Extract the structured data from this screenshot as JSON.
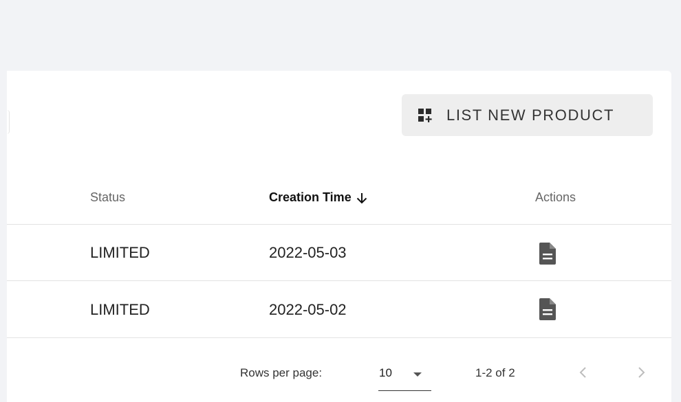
{
  "toolbar": {
    "list_button_label": "LIST NEW PRODUCT",
    "list_button_icon": "add-grid-icon"
  },
  "table": {
    "columns": [
      {
        "key": "status",
        "label": "Status"
      },
      {
        "key": "creation_time",
        "label": "Creation Time",
        "sort": "descending"
      },
      {
        "key": "actions",
        "label": "Actions"
      }
    ],
    "rows": [
      {
        "status": "LIMITED",
        "creation_time": "2022-05-03",
        "action_icon": "document-icon"
      },
      {
        "status": "LIMITED",
        "creation_time": "2022-05-02",
        "action_icon": "document-icon"
      }
    ]
  },
  "pagination": {
    "rows_per_page_label": "Rows per page:",
    "rows_per_page_value": "10",
    "range_text": "1-2 of 2"
  },
  "colors": {
    "page_background": "#f2f3f6",
    "card_background": "#ffffff",
    "button_background": "#eeeeee",
    "icon_gray": "#555555",
    "disabled_gray": "#bdbdbd"
  }
}
